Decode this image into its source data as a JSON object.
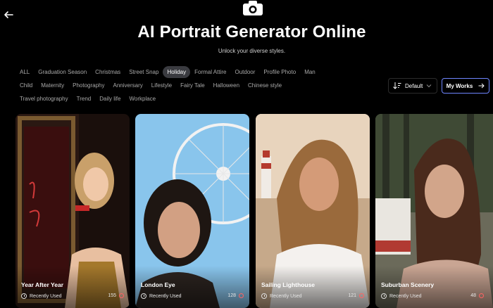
{
  "header": {
    "title": "AI Portrait Generator Online",
    "subtitle": "Unlock your diverse styles."
  },
  "categories": {
    "row1": [
      "ALL",
      "Graduation Season",
      "Christmas",
      "Street Snap",
      "Holiday",
      "Formal Attire",
      "Outdoor",
      "Profile Photo",
      "Man"
    ],
    "row2": [
      "Child",
      "Maternity",
      "Photography",
      "Anniversary",
      "Lifestyle",
      "Fairy Tale",
      "Halloween",
      "Chinese style"
    ],
    "row3": [
      "Travel photography",
      "Trend",
      "Daily life",
      "Workplace"
    ],
    "active": "Holiday"
  },
  "toolbar": {
    "sort_label": "Default",
    "my_works_label": "My Works"
  },
  "cards": [
    {
      "name": "Year After Year",
      "status": "Recently Used",
      "count": "155"
    },
    {
      "name": "London Eye",
      "status": "Recently Used",
      "count": "128"
    },
    {
      "name": "Sailing Lighthouse",
      "status": "Recently Used",
      "count": "121"
    },
    {
      "name": "Suburban Scenery",
      "status": "Recently Used",
      "count": "48"
    }
  ],
  "colors": {
    "background": "#000000",
    "accent_border": "#6e86ff",
    "active_tag_bg": "#3a3b40",
    "heart": "#ff6262"
  }
}
